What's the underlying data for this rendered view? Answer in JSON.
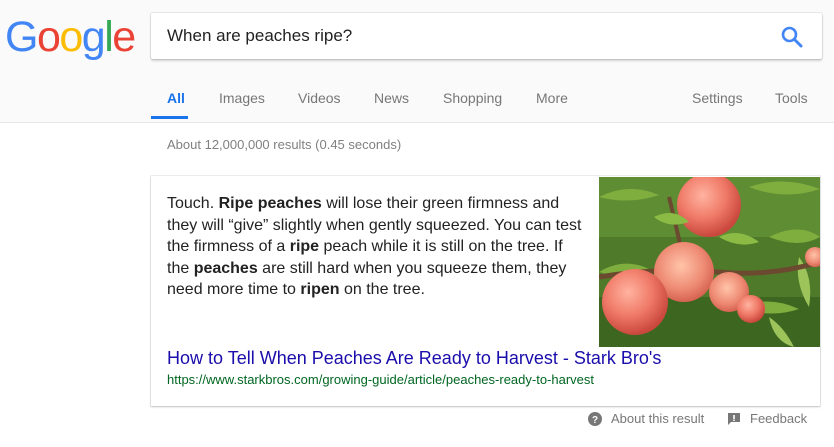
{
  "logo": {
    "text": "Google",
    "letters": [
      "G",
      "o",
      "o",
      "g",
      "l",
      "e"
    ],
    "colors": [
      "#4285F4",
      "#EA4335",
      "#FBBC05",
      "#4285F4",
      "#34A853",
      "#EA4335"
    ]
  },
  "search": {
    "query": "When are peaches ripe?",
    "icon": "search-icon"
  },
  "tabs": [
    {
      "label": "All",
      "active": true
    },
    {
      "label": "Images"
    },
    {
      "label": "Videos"
    },
    {
      "label": "News"
    },
    {
      "label": "Shopping"
    },
    {
      "label": "More"
    },
    {
      "label": "Settings"
    },
    {
      "label": "Tools"
    }
  ],
  "stats": "About 12,000,000 results (0.45 seconds)",
  "snippet": {
    "segments": [
      {
        "text": "Touch. "
      },
      {
        "text": "Ripe peaches",
        "bold": true
      },
      {
        "text": " will lose their green firmness and they will “give” slightly when gently squeezed. You can test the firmness of a "
      },
      {
        "text": "ripe",
        "bold": true
      },
      {
        "text": " peach while it is still on the tree. If the "
      },
      {
        "text": "peaches",
        "bold": true
      },
      {
        "text": " are still hard when you squeeze them, they need more time to "
      },
      {
        "text": "ripen",
        "bold": true
      },
      {
        "text": " on the tree."
      }
    ]
  },
  "result": {
    "title": "How to Tell When Peaches Are Ready to Harvest - Stark Bro's",
    "url": "https://www.starkbros.com/growing-guide/article/peaches-ready-to-harvest"
  },
  "footer": {
    "about": {
      "label": "About this result",
      "icon": "help-circle-icon"
    },
    "feedback": {
      "label": "Feedback",
      "icon": "feedback-icon"
    }
  },
  "colors": {
    "accent": "#1a73e8",
    "link": "#1a0dab",
    "url": "#006621"
  }
}
